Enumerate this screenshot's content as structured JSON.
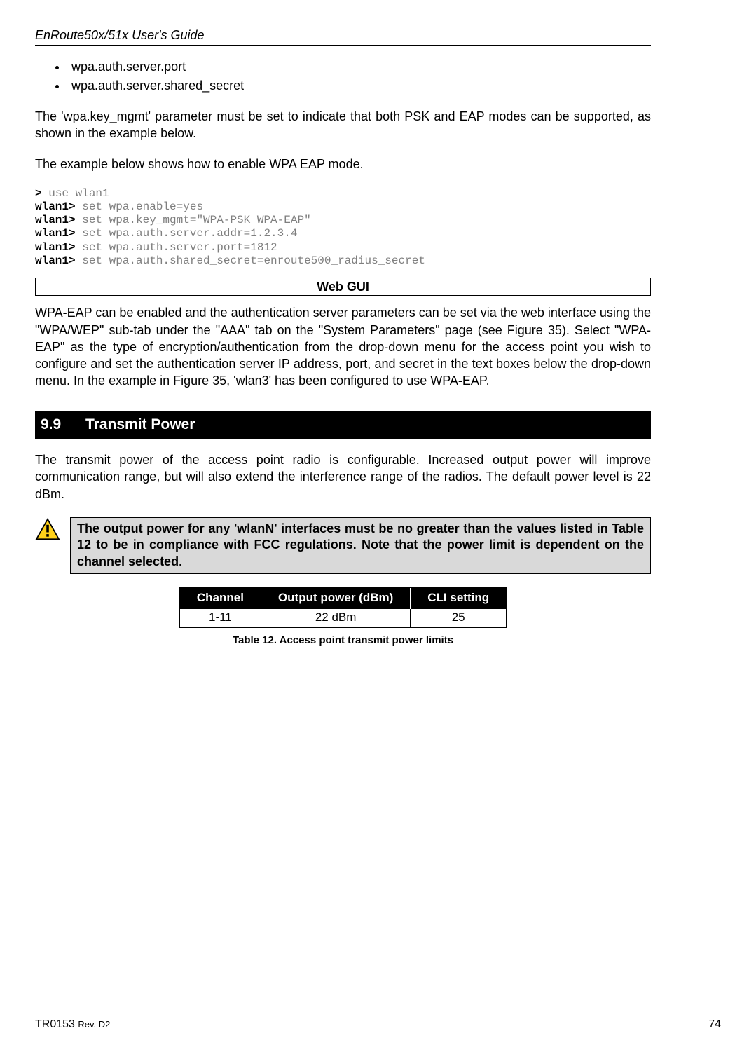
{
  "header": {
    "title": "EnRoute50x/51x User's Guide"
  },
  "bullets": [
    "wpa.auth.server.port",
    "wpa.auth.server.shared_secret"
  ],
  "para1": "The 'wpa.key_mgmt' parameter must be set to indicate that both PSK and EAP modes can be supported, as shown in the example below.",
  "para2": "The example below shows how to enable WPA EAP mode.",
  "code": {
    "l1_prompt": ">",
    "l1_cmd": " use wlan1",
    "l2_prompt": "wlan1>",
    "l2_cmd": " set wpa.enable=yes",
    "l3_prompt": "wlan1>",
    "l3_cmd": " set wpa.key_mgmt=\"WPA-PSK WPA-EAP\"",
    "l4_prompt": "wlan1>",
    "l4_cmd": " set wpa.auth.server.addr=1.2.3.4",
    "l5_prompt": "wlan1>",
    "l5_cmd": " set wpa.auth.server.port=1812",
    "l6_prompt": "wlan1>",
    "l6_cmd": " set wpa.auth.shared_secret=enroute500_radius_secret"
  },
  "webgui_label": "Web GUI",
  "para3": "WPA-EAP can be enabled and the authentication server parameters can be set via the web interface using the \"WPA/WEP\" sub-tab under the \"AAA\" tab on the \"System Parameters\" page (see Figure 35). Select \"WPA-EAP\" as the type of encryption/authentication from the drop-down menu for the access point you wish to configure and set the authentication server  IP address, port, and secret in the text boxes below the drop-down menu. In the example in Figure 35, 'wlan3' has been configured to use WPA-EAP.",
  "section": {
    "num": "9.9",
    "title": "Transmit Power"
  },
  "para4": "The transmit power of the access point radio is configurable. Increased output power will improve communication range, but will also extend the interference range of the radios. The default power level is 22 dBm.",
  "warning": "The output power for any 'wlanN' interfaces must be no greater than the values listed in Table 12 to be in compliance with FCC regulations. Note that the power limit is dependent on the channel selected.",
  "table": {
    "headers": [
      "Channel",
      "Output power (dBm)",
      "CLI setting"
    ],
    "rows": [
      [
        "1-11",
        "22 dBm",
        "25"
      ]
    ]
  },
  "table_caption": "Table 12. Access point transmit power limits",
  "footer": {
    "doc": "TR0153 ",
    "rev": "Rev. D2",
    "page": "74"
  },
  "chart_data": {
    "type": "table",
    "title": "Access point transmit power limits",
    "columns": [
      "Channel",
      "Output power (dBm)",
      "CLI setting"
    ],
    "rows": [
      {
        "Channel": "1-11",
        "Output power (dBm)": "22 dBm",
        "CLI setting": "25"
      }
    ]
  }
}
